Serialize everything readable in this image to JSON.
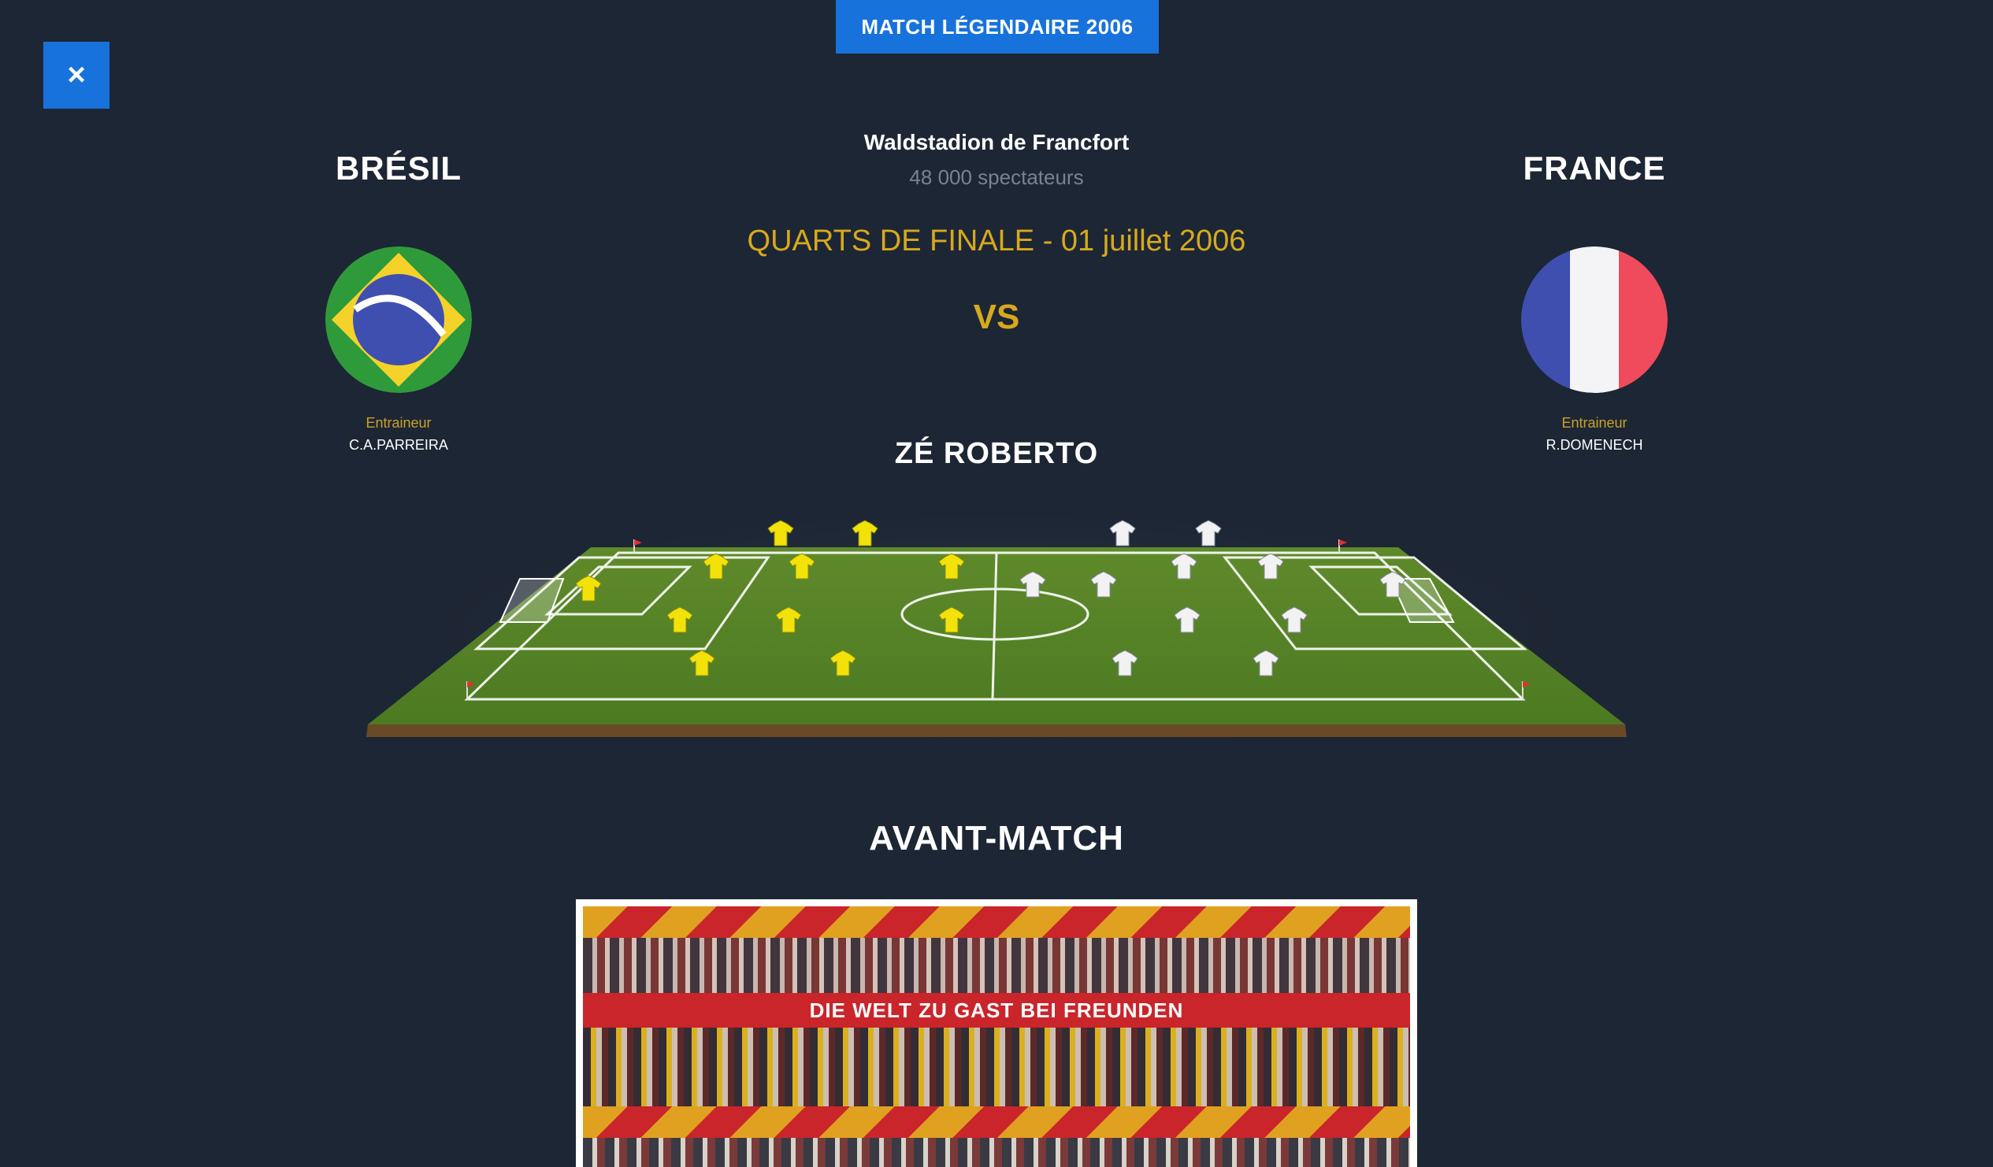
{
  "badge": "MATCH LÉGENDAIRE 2006",
  "close_label": "×",
  "home": {
    "name": "BRÉSIL",
    "coach_label": "Entraineur",
    "coach": "C.A.PARREIRA"
  },
  "away": {
    "name": "FRANCE",
    "coach_label": "Entraineur",
    "coach": "R.DOMENECH"
  },
  "match": {
    "stadium": "Waldstadion de Francfort",
    "spectators": "48 000 spectateurs",
    "round": "QUARTS DE FINALE - 01 juillet 2006",
    "vs": "VS",
    "highlighted_player": "ZÉ ROBERTO"
  },
  "section": {
    "title": "AVANT-MATCH"
  },
  "photo": {
    "banner_text": "DIE WELT ZU GAST BEI FREUNDEN"
  },
  "colors": {
    "background": "#1d2634",
    "accent_blue": "#1872db",
    "gold": "#d7a91d",
    "brazil_shirt": "#f2e20a",
    "france_shirt": "#f2f2f2"
  }
}
